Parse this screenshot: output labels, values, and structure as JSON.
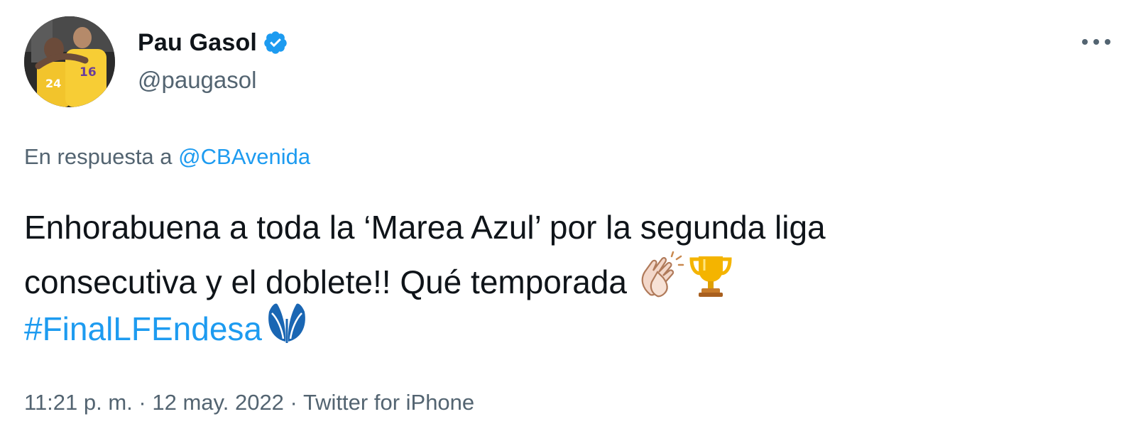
{
  "author": {
    "display_name": "Pau Gasol",
    "handle": "@paugasol",
    "verified": true,
    "avatar_icon": "profile-photo-basketball-players"
  },
  "more_icon": "ellipsis-horizontal-icon",
  "reply_context": {
    "prefix": "En respuesta a",
    "mention": "@CBAvenida"
  },
  "tweet": {
    "line1": "Enhorabuena a toda la ‘Marea Azul’ por la segunda liga",
    "line2": "consecutiva y el doblete!! Qué temporada",
    "hashtag": "#FinalLFEndesa",
    "emojis": [
      "clapping-hands-icon",
      "trophy-icon",
      "liga-endesa-logo-icon"
    ]
  },
  "meta": {
    "time": "11:21 p. m.",
    "sep1": "·",
    "date": "12 may. 2022",
    "sep2": "·",
    "source": "Twitter for iPhone"
  },
  "colors": {
    "text_primary": "#0f1419",
    "text_secondary": "#536471",
    "link": "#1d9bf0",
    "verified": "#1d9bf0",
    "avatar_jersey": "#f2c42c"
  }
}
